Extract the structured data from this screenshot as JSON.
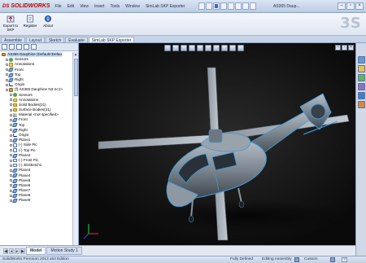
{
  "app": {
    "logo_brand": "SOLIDWORKS",
    "logo_prefix": "DS",
    "document_title": "AS365 Daup...",
    "menus": [
      "File",
      "Edit",
      "View",
      "Insert",
      "Tools",
      "Window",
      "SimLab SKP Exporter"
    ]
  },
  "command_manager": {
    "export_label": "Export to SKP",
    "register_label": "Register",
    "about_label": "About"
  },
  "tabs": [
    "Assemble",
    "Layout",
    "Sketch",
    "Evaluate",
    "SimLab SKP Exporter"
  ],
  "active_tab": "SimLab SKP Exporter",
  "feature_tree": {
    "items": [
      {
        "label": "AS365 Dauphine  (Default<Defau",
        "icon": "assembly-icon",
        "indent": 0
      },
      {
        "label": "Sensors",
        "icon": "sensor-icon",
        "indent": 1
      },
      {
        "label": "Annotations",
        "icon": "annotation-icon",
        "indent": 1
      },
      {
        "label": "Front",
        "icon": "plane-icon",
        "indent": 1
      },
      {
        "label": "Top",
        "icon": "plane-icon",
        "indent": 1
      },
      {
        "label": "Right",
        "icon": "plane-icon",
        "indent": 1
      },
      {
        "label": "Origin",
        "icon": "origin-icon",
        "indent": 1
      },
      {
        "label": "(f) AS365 Dauphine N3 2<1>",
        "icon": "part-icon",
        "indent": 1
      },
      {
        "label": "Sensors",
        "icon": "sensor-icon",
        "indent": 2
      },
      {
        "label": "Annotations",
        "icon": "annotation-icon",
        "indent": 2
      },
      {
        "label": "Solid Bodies(21)",
        "icon": "folder-icon",
        "indent": 2
      },
      {
        "label": "Surface Bodies(31)",
        "icon": "folder-icon",
        "indent": 2
      },
      {
        "label": "Material <not specified>",
        "icon": "material-icon",
        "indent": 2
      },
      {
        "label": "Front",
        "icon": "plane-icon",
        "indent": 2
      },
      {
        "label": "Top",
        "icon": "plane-icon",
        "indent": 2
      },
      {
        "label": "Right",
        "icon": "plane-icon",
        "indent": 2
      },
      {
        "label": "Origin",
        "icon": "origin-icon",
        "indent": 2
      },
      {
        "label": "Plane1",
        "icon": "plane-icon",
        "indent": 2
      },
      {
        "label": "(-) Side Pic",
        "icon": "sketch-icon",
        "indent": 2
      },
      {
        "label": "(-) Top Pic",
        "icon": "sketch-icon",
        "indent": 2
      },
      {
        "label": "Plane2",
        "icon": "plane-icon",
        "indent": 2
      },
      {
        "label": "(-) Front Pic",
        "icon": "sketch-icon",
        "indent": 2
      },
      {
        "label": "(-) 3DSketch1",
        "icon": "sketch-icon",
        "indent": 2
      },
      {
        "label": "Plane3",
        "icon": "plane-icon",
        "indent": 2
      },
      {
        "label": "Plane4",
        "icon": "plane-icon",
        "indent": 2
      },
      {
        "label": "Plane5",
        "icon": "plane-icon",
        "indent": 2
      },
      {
        "label": "Plane6",
        "icon": "plane-icon",
        "indent": 2
      },
      {
        "label": "Plane7",
        "icon": "plane-icon",
        "indent": 2
      },
      {
        "label": "Plane8",
        "icon": "plane-icon",
        "indent": 2
      },
      {
        "label": "Plane9",
        "icon": "plane-icon",
        "indent": 2
      }
    ]
  },
  "bottom_tabs": [
    "Model",
    "Motion Study 1"
  ],
  "active_bottom_tab": "Model",
  "status_bar": {
    "edition": "SolidWorks Premium 2013 x64 Edition",
    "defined": "Fully Defined",
    "mode": "Editing Assembly",
    "units": "Custom",
    "help": "?"
  },
  "colors": {
    "accent": "#c00000",
    "viewport_bg": "#111111",
    "helicopter_body": "#7d8791",
    "outline_blue": "#3a9bd9"
  }
}
